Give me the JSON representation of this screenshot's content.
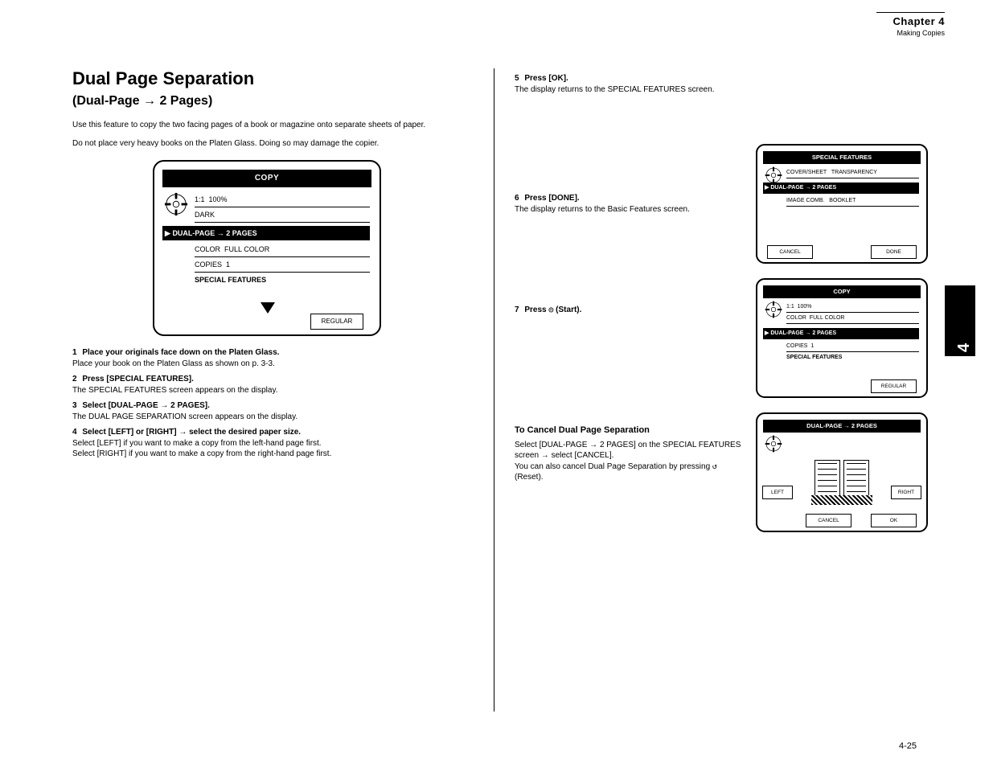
{
  "header": {
    "chapter": "Chapter 4",
    "subtitle": "Making Copies"
  },
  "sidetab": "4",
  "left": {
    "title": "Dual Page Separation",
    "subtitle": "(Dual-Page → 2 Pages)",
    "intro": "Use this feature to copy the two facing pages of a book or magazine onto separate sheets of paper.",
    "caution": "Do not place very heavy books on the Platen Glass. Doing so may damage the copier.",
    "lcd": {
      "title": "COPY",
      "rows": [
        "1:1",
        "COLOR",
        "COPIES"
      ],
      "selected": "DUAL-PAGE → 2 PAGES",
      "values": [
        "100%",
        "FULL COLOR",
        "1"
      ],
      "dark_label": "DARK",
      "special": "SPECIAL FEATURES",
      "button": "REGULAR"
    },
    "steps": [
      {
        "n": "1",
        "text": "Place your originals face down on the Platen Glass.",
        "extra": "Place your book on the Platen Glass as shown on p. 3-3."
      },
      {
        "n": "2",
        "text": "Press [SPECIAL FEATURES].",
        "extra": "The SPECIAL FEATURES screen appears on the display."
      },
      {
        "n": "3",
        "text": "Select [DUAL-PAGE → 2 PAGES].",
        "extra": "The DUAL PAGE SEPARATION screen appears on the display."
      },
      {
        "n": "4",
        "text": "Select [LEFT] or [RIGHT] → select the desired paper size.",
        "extra_a": "Select [LEFT] if you want to make a copy from the left-hand page first.",
        "extra_b": "Select [RIGHT] if you want to make a copy from the right-hand page first."
      }
    ]
  },
  "right": {
    "steps": [
      {
        "n": "5",
        "text": "Press [OK].",
        "extra": "The display returns to the SPECIAL FEATURES screen."
      },
      {
        "n": "6",
        "text": "Press [DONE].",
        "extra": "The display returns to the Basic Features screen."
      },
      {
        "n": "7",
        "text": "Press  (Start)."
      }
    ],
    "cancel": {
      "title": "To Cancel Dual Page Separation",
      "a": "Select [DUAL-PAGE → 2 PAGES] on the SPECIAL FEATURES screen → select [CANCEL].",
      "b": "You can also cancel Dual Page Separation by pressing  (Reset)."
    },
    "panels": [
      {
        "title": "SPECIAL FEATURES",
        "rows": [
          "COVER/SHEET",
          "IMAGE COMB."
        ],
        "selected": "DUAL-PAGE → 2 PAGES",
        "right_rows": [
          "TRANSPARENCY",
          "BOOKLET"
        ],
        "btn_left": "CANCEL",
        "btn_right": "DONE"
      },
      {
        "title": "COPY",
        "rows": [
          "1:1",
          "COLOR",
          "COPIES"
        ],
        "selected": "DUAL-PAGE → 2 PAGES",
        "values": [
          "100%",
          "FULL COLOR",
          "1"
        ],
        "special": "SPECIAL FEATURES",
        "btn_right": "REGULAR"
      },
      {
        "title": "DUAL-PAGE → 2 PAGES",
        "hint_left": "LEFT",
        "hint_right": "RIGHT",
        "btn_left": "CANCEL",
        "btn_right": "OK"
      }
    ]
  },
  "pageno": "4-25",
  "glyph": {
    "start": "◎",
    "reset": "↺",
    "caret": "▶"
  }
}
